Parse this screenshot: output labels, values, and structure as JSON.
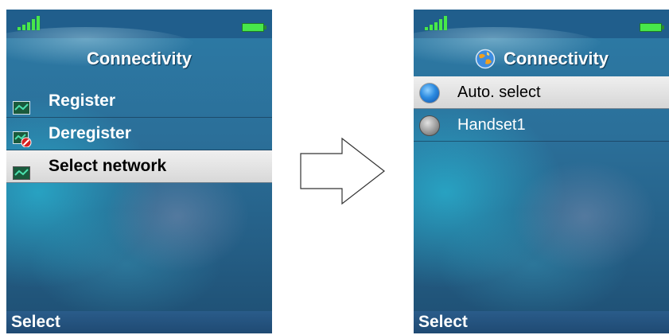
{
  "left_screen": {
    "title": "Connectivity",
    "menu_items": [
      {
        "label": "Register",
        "icon": "network-icon",
        "selected": false
      },
      {
        "label": "Deregister",
        "icon": "network-deregister-icon",
        "selected": false
      },
      {
        "label": "Select network",
        "icon": "network-icon",
        "selected": true
      }
    ],
    "softkey": "Select"
  },
  "arrow": {
    "icon": "right-arrow-icon"
  },
  "right_screen": {
    "title": "Connectivity",
    "title_icon": "connectivity-globe-icon",
    "options": [
      {
        "label": "Auto. select",
        "selected": true
      },
      {
        "label": "Handset1",
        "selected": false
      }
    ],
    "softkey": "Select"
  },
  "colors": {
    "background": "#2b6f99",
    "status_bar": "#205e8c",
    "selection": "#e4e4e4",
    "indicator_green": "#48e84a",
    "softkey_bar": "#1f4a73"
  }
}
